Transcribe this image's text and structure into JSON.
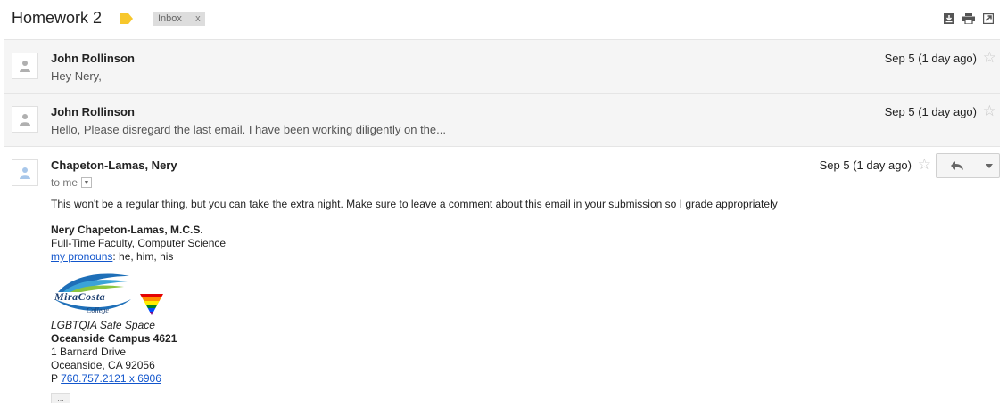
{
  "subject": "Homework 2",
  "label_chip": {
    "text": "Inbox",
    "remove": "x"
  },
  "messages": [
    {
      "sender": "John Rollinson",
      "snippet": "Hey Nery,",
      "date": "Sep 5 (1 day ago)"
    },
    {
      "sender": "John Rollinson",
      "snippet": "Hello, Please disregard the last email. I have been working diligently on the...",
      "date": "Sep 5 (1 day ago)"
    }
  ],
  "open_message": {
    "sender": "Chapeton-Lamas, Nery",
    "to": "to me",
    "date": "Sep 5 (1 day ago)",
    "body": "This won't be a regular thing, but you can take the extra night. Make sure to leave a comment about this email in your submission so I grade appropriately",
    "signature": {
      "name": "Nery Chapeton-Lamas, M.C.S.",
      "title": "Full-Time Faculty, Computer Science",
      "pronoun_link": "my pronouns",
      "pronouns": ": he, him, his",
      "logo_word": "MiraCosta",
      "logo_sub": "College",
      "safe_space": "LGBTQIA Safe Space",
      "campus": "Oceanside Campus 4621",
      "address1": "1 Barnard Drive",
      "address2": "Oceanside, CA 92056",
      "phone_prefix": "P ",
      "phone": "760.757.2121 x 6906"
    },
    "trimmed": "..."
  },
  "colors": {
    "label_yellow": "#f7c72c",
    "link": "#1155cc",
    "chip_bg": "#dddddd"
  },
  "icons": [
    "label-icon",
    "download-icon",
    "print-icon",
    "new-window-icon",
    "avatar-icon",
    "star-icon",
    "reply-icon",
    "more-options-icon",
    "rainbow-triangle-icon"
  ]
}
